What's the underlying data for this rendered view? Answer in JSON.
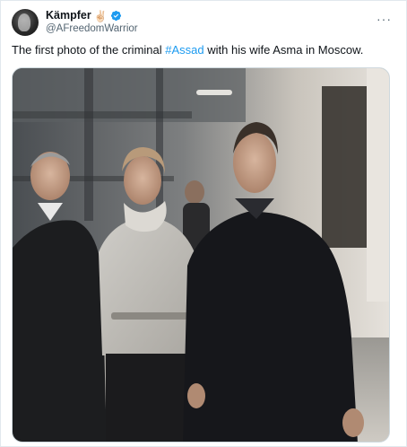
{
  "tweet": {
    "author": {
      "display_name": "Kämpfer",
      "emoji": "✌🏻",
      "handle": "@AFreedomWarrior",
      "verified_icon": "verified-badge-icon"
    },
    "more_label": "···",
    "text_before": "The first photo of the criminal ",
    "hashtag": "#Assad",
    "text_after": " with his wife Asma in Moscow."
  },
  "colors": {
    "accent": "#1d9bf0",
    "secondary_text": "#536471",
    "border": "#cfd9de"
  }
}
